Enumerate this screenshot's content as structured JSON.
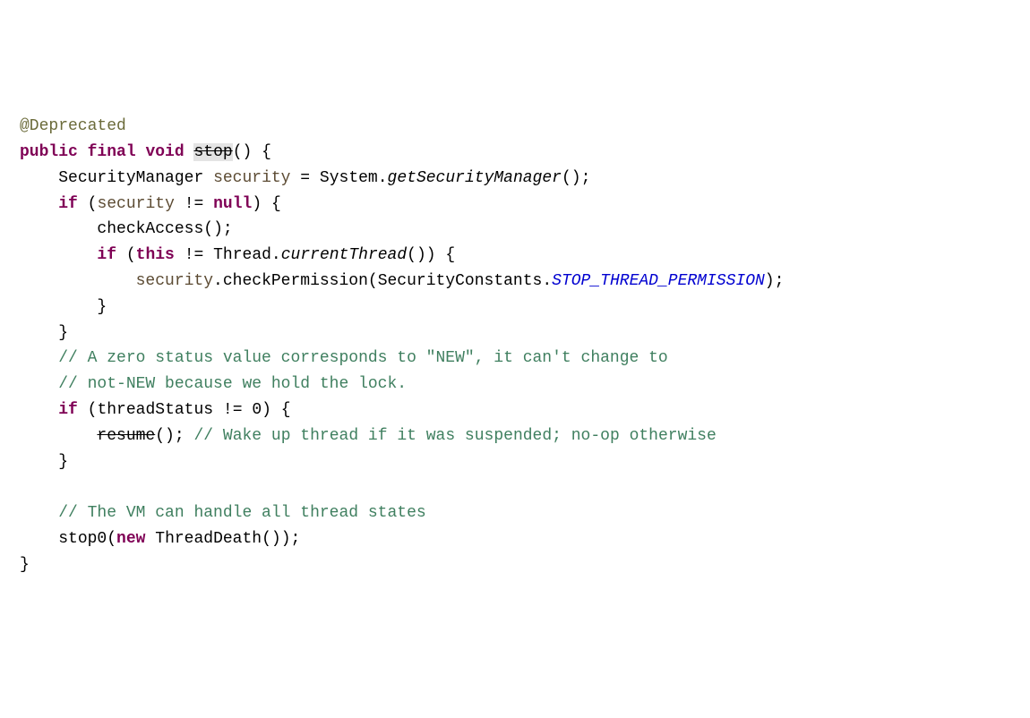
{
  "code": {
    "annotation": "@Deprecated",
    "mod_public": "public",
    "mod_final": "final",
    "ret_void": "void",
    "method_name": "stop",
    "parens_open": "(",
    "parens_close": ")",
    "brace_open": "{",
    "brace_close": "}",
    "type_SecurityManager": "SecurityManager",
    "var_security": "security",
    "op_assign": "=",
    "class_System": "System",
    "dot": ".",
    "call_getSecurityManager": "getSecurityManager",
    "semi": ";",
    "kw_if": "if",
    "op_ne": "!=",
    "kw_null": "null",
    "call_checkAccess": "checkAccess",
    "kw_this": "this",
    "class_Thread": "Thread",
    "call_currentThread": "currentThread",
    "call_checkPermission": "checkPermission",
    "class_SecurityConstants": "SecurityConstants",
    "const_STOP_THREAD_PERMISSION": "STOP_THREAD_PERMISSION",
    "comment1": "// A zero status value corresponds to \"NEW\", it can't change to",
    "comment2": "// not-NEW because we hold the lock.",
    "var_threadStatus": "threadStatus",
    "num_zero": "0",
    "call_resume": "resume",
    "comment3": "// Wake up thread if it was suspended; no-op otherwise",
    "comment4": "// The VM can handle all thread states",
    "call_stop0": "stop0",
    "kw_new": "new",
    "class_ThreadDeath": "ThreadDeath"
  }
}
